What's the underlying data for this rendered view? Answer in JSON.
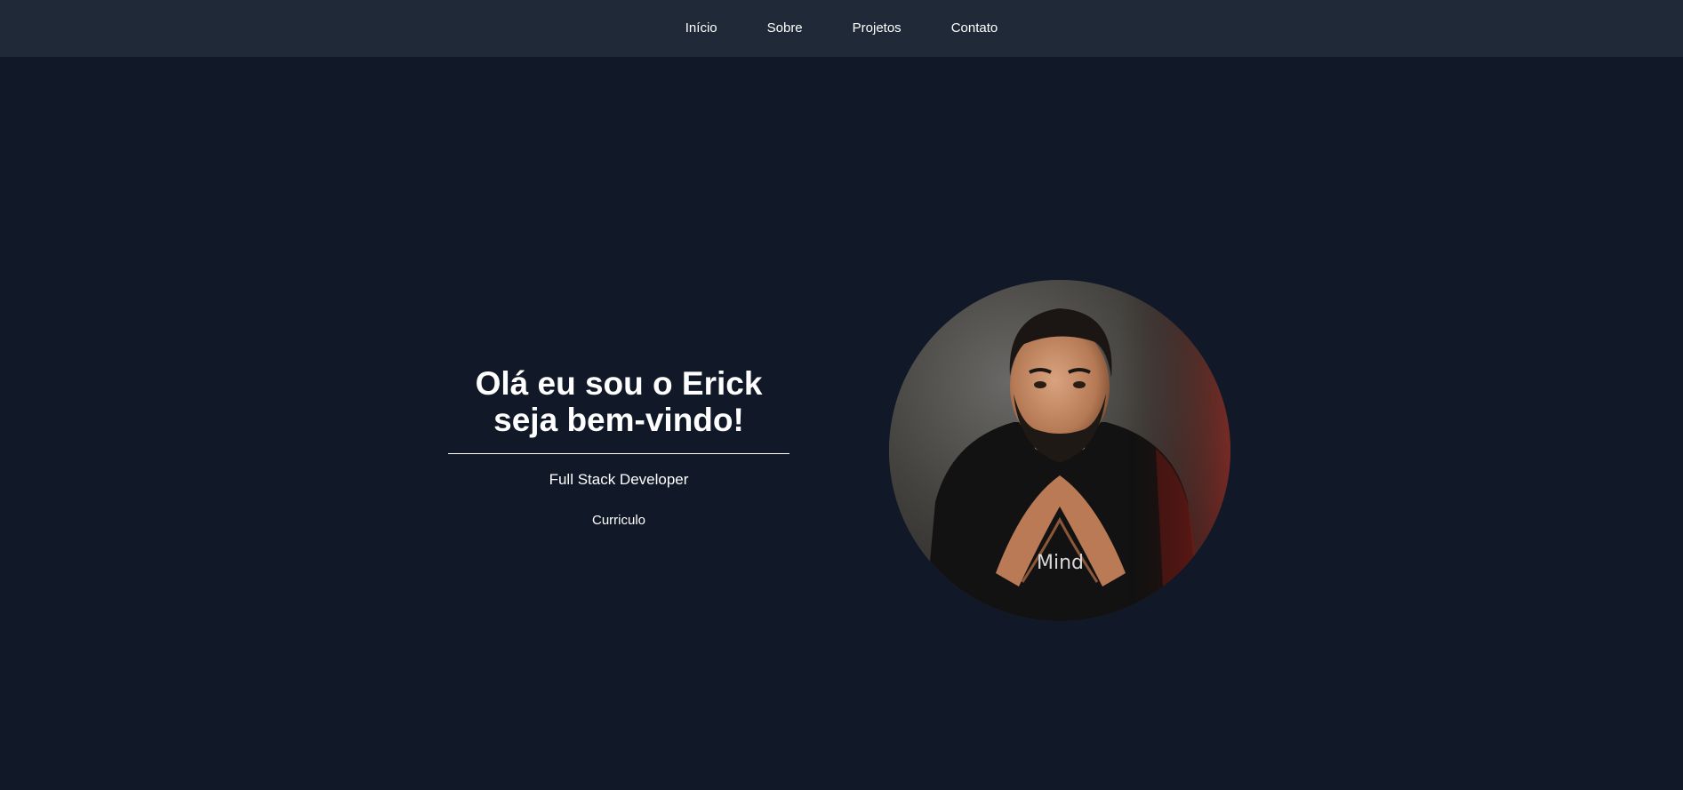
{
  "nav": {
    "items": [
      {
        "label": "Início"
      },
      {
        "label": "Sobre"
      },
      {
        "label": "Projetos"
      },
      {
        "label": "Contato"
      }
    ]
  },
  "hero": {
    "title_line1": "Olá eu sou o Erick",
    "title_line2": "seja bem-vindo!",
    "subtitle": "Full Stack Developer",
    "resume_label": "Curriculo",
    "shirt_text": "Mind"
  },
  "colors": {
    "background": "#111827",
    "navbar": "#1f2937",
    "text": "#ffffff"
  }
}
